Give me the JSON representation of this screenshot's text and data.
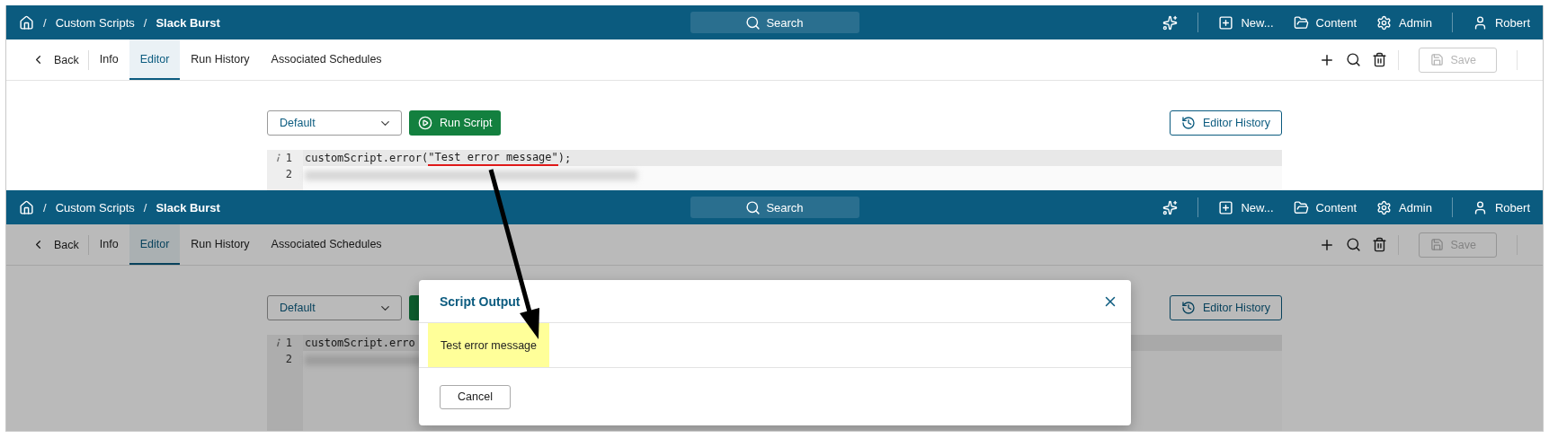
{
  "screens": [
    {
      "breadcrumbs": [
        "Custom Scripts",
        "Slack Burst"
      ],
      "breadcrumb_separator": "/",
      "search": {
        "placeholder": "Search"
      },
      "nav": [
        {
          "kind": "new",
          "label": "New..."
        },
        {
          "kind": "content",
          "label": "Content"
        },
        {
          "kind": "admin",
          "label": "Admin"
        },
        {
          "kind": "user",
          "label": "Robert"
        }
      ],
      "back": "Back",
      "tabs": [
        {
          "label": "Info",
          "selected": false
        },
        {
          "label": "Editor",
          "selected": true
        },
        {
          "label": "Run History",
          "selected": false
        },
        {
          "label": "Associated Schedules",
          "selected": false
        }
      ],
      "save": {
        "label": "Save",
        "disabled": true
      },
      "script_select": {
        "value": "Default"
      },
      "run_button": "Run Script",
      "history_button": "Editor History",
      "code_lines": [
        {
          "number": "1",
          "active": true,
          "tokens": [
            {
              "text": "customScript.error(",
              "underlined": false
            },
            {
              "text": "\"Test error message\"",
              "underlined": true
            },
            {
              "text": ");",
              "underlined": false
            }
          ]
        },
        {
          "number": "2",
          "active": false,
          "redacted": true
        }
      ],
      "dimmed": false
    },
    {
      "breadcrumbs": [
        "Custom Scripts",
        "Slack Burst"
      ],
      "search": {
        "placeholder": "Search"
      },
      "nav": [
        {
          "kind": "new",
          "label": "New..."
        },
        {
          "kind": "content",
          "label": "Content"
        },
        {
          "kind": "admin",
          "label": "Admin"
        },
        {
          "kind": "user",
          "label": "Robert"
        }
      ],
      "back": "Back",
      "tabs": [
        {
          "label": "Info",
          "selected": false
        },
        {
          "label": "Editor",
          "selected": true
        },
        {
          "label": "Run History",
          "selected": false
        },
        {
          "label": "Associated Schedules",
          "selected": false
        }
      ],
      "save": {
        "label": "Save",
        "disabled": true
      },
      "script_select": {
        "value": "Default"
      },
      "history_button": "Editor History",
      "code_lines": [
        {
          "number": "1",
          "active": true,
          "tokens": [
            {
              "text": "customScript.erro",
              "underlined": false
            }
          ]
        },
        {
          "number": "2",
          "active": false,
          "redacted": true
        }
      ],
      "dimmed": true,
      "breadcrumb_separator": "/",
      "dialog": {
        "title": "Script Output",
        "message": "Test error message",
        "highlighted": true,
        "cancel": "Cancel"
      }
    }
  ],
  "arrow": true
}
